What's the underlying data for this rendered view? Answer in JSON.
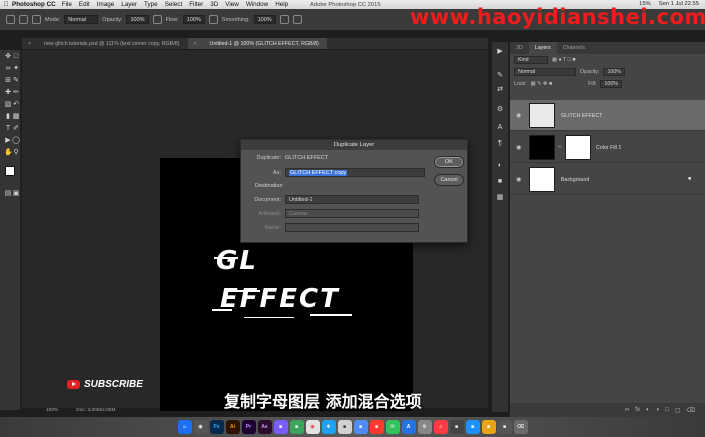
{
  "menubar": {
    "app": "Photoshop CC",
    "items": [
      "File",
      "Edit",
      "Image",
      "Layer",
      "Type",
      "Select",
      "Filter",
      "3D",
      "View",
      "Window",
      "Help"
    ],
    "window_title": "Adobe Photoshop CC 2015",
    "battery": "15%",
    "clock": "Sen 1 Jul 22.55"
  },
  "watermark": "www.haoyidianshei.com",
  "options_bar": {
    "mode_label": "Mode:",
    "mode_value": "Normal",
    "opacity_label": "Opacity:",
    "opacity_value": "100%",
    "flow_label": "Flow:",
    "flow_value": "100%",
    "smoothing_label": "Smoothing:",
    "smoothing_value": "100%"
  },
  "tabs": [
    {
      "label": "new glitch tutorials.psd @ 111% (text comer copy, RGB/8)",
      "active": false
    },
    {
      "label": "Untitled-1 @ 100% (GLITCH EFFECT, RGB/8)",
      "active": true
    }
  ],
  "canvas": {
    "line1": "GL",
    "line2": "EFFECT"
  },
  "status_bar": {
    "zoom": "100%",
    "doc": "Doc: 3,00M/2,00M"
  },
  "dialog": {
    "title": "Duplicate Layer",
    "duplicate_label": "Duplicate:",
    "duplicate_value": "GLITCH EFFECT",
    "as_label": "As:",
    "as_value": "GLITCH EFFECT copy",
    "destination_label": "Destination",
    "document_label": "Document:",
    "document_value": "Untitled-1",
    "artboard_label": "Artboard:",
    "artboard_value": "Canvas",
    "name_label": "Name:",
    "name_value": "",
    "ok_label": "OK",
    "cancel_label": "Cancel"
  },
  "panel": {
    "tabs": [
      "3D",
      "Layers",
      "Channels"
    ],
    "active_tab": "Layers",
    "filter_label": "Kind",
    "blend_mode": "Normal",
    "opacity_label": "Opacity:",
    "opacity_value": "100%",
    "lock_label": "Lock:",
    "fill_label": "Fill:",
    "fill_value": "100%",
    "layers": [
      {
        "name": "GLITCH EFFECT",
        "selected": true
      },
      {
        "name": "Color Fill 1",
        "selected": false
      },
      {
        "name": "Background",
        "selected": false
      }
    ]
  },
  "overlay": {
    "subscribe": "SUBSCRIBE",
    "caption": "复制字母图层 添加混合选项"
  },
  "colors": {
    "watermark": "#ee1c1c",
    "selection": "#3b74d9",
    "panel_bg": "#454545",
    "workspace_bg": "#282828"
  }
}
